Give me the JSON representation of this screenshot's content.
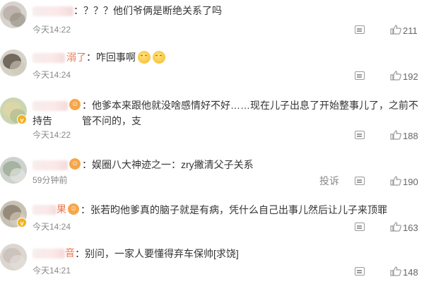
{
  "comments": [
    {
      "name_visible": "",
      "text": "：？？？他们爷俩是断绝关系了吗",
      "time": "今天14:22",
      "likes": "211"
    },
    {
      "name_visible": "溺了",
      "text": "：咋回事啊",
      "time": "今天14:24",
      "likes": "192"
    },
    {
      "name_visible": "",
      "text_line1": "：他爹本来跟他就没啥感情好不好……现在儿子出息了开始整事儿了，之前不管不问的，支",
      "text_line2": "持告",
      "time": "今天14:22",
      "likes": "188"
    },
    {
      "name_visible": "",
      "text": "：娱圈八大神迹之一：zry撇清父子关系",
      "time": "59分钟前",
      "report": "投诉",
      "likes": "190"
    },
    {
      "name_visible": "果",
      "text": "：张若昀他爹真的脑子就是有病，凭什么自己出事儿然后让儿子来顶罪",
      "time": "今天14:24",
      "likes": "163"
    },
    {
      "name_visible": "音",
      "text": "：别问，一家人要懂得弃车保帅[求饶]",
      "time": "今天14:21",
      "likes": "148"
    }
  ],
  "icons": {
    "reply": "comment-reply-icon",
    "like": "thumbs-up-icon",
    "medal": "fan-medal-icon",
    "verified": "verified-badge-icon",
    "emoji": "awkward-face-emoji"
  },
  "colors": {
    "name": "#eb7350",
    "badge": "#f3b11e",
    "muted": "#8a8a8a"
  }
}
